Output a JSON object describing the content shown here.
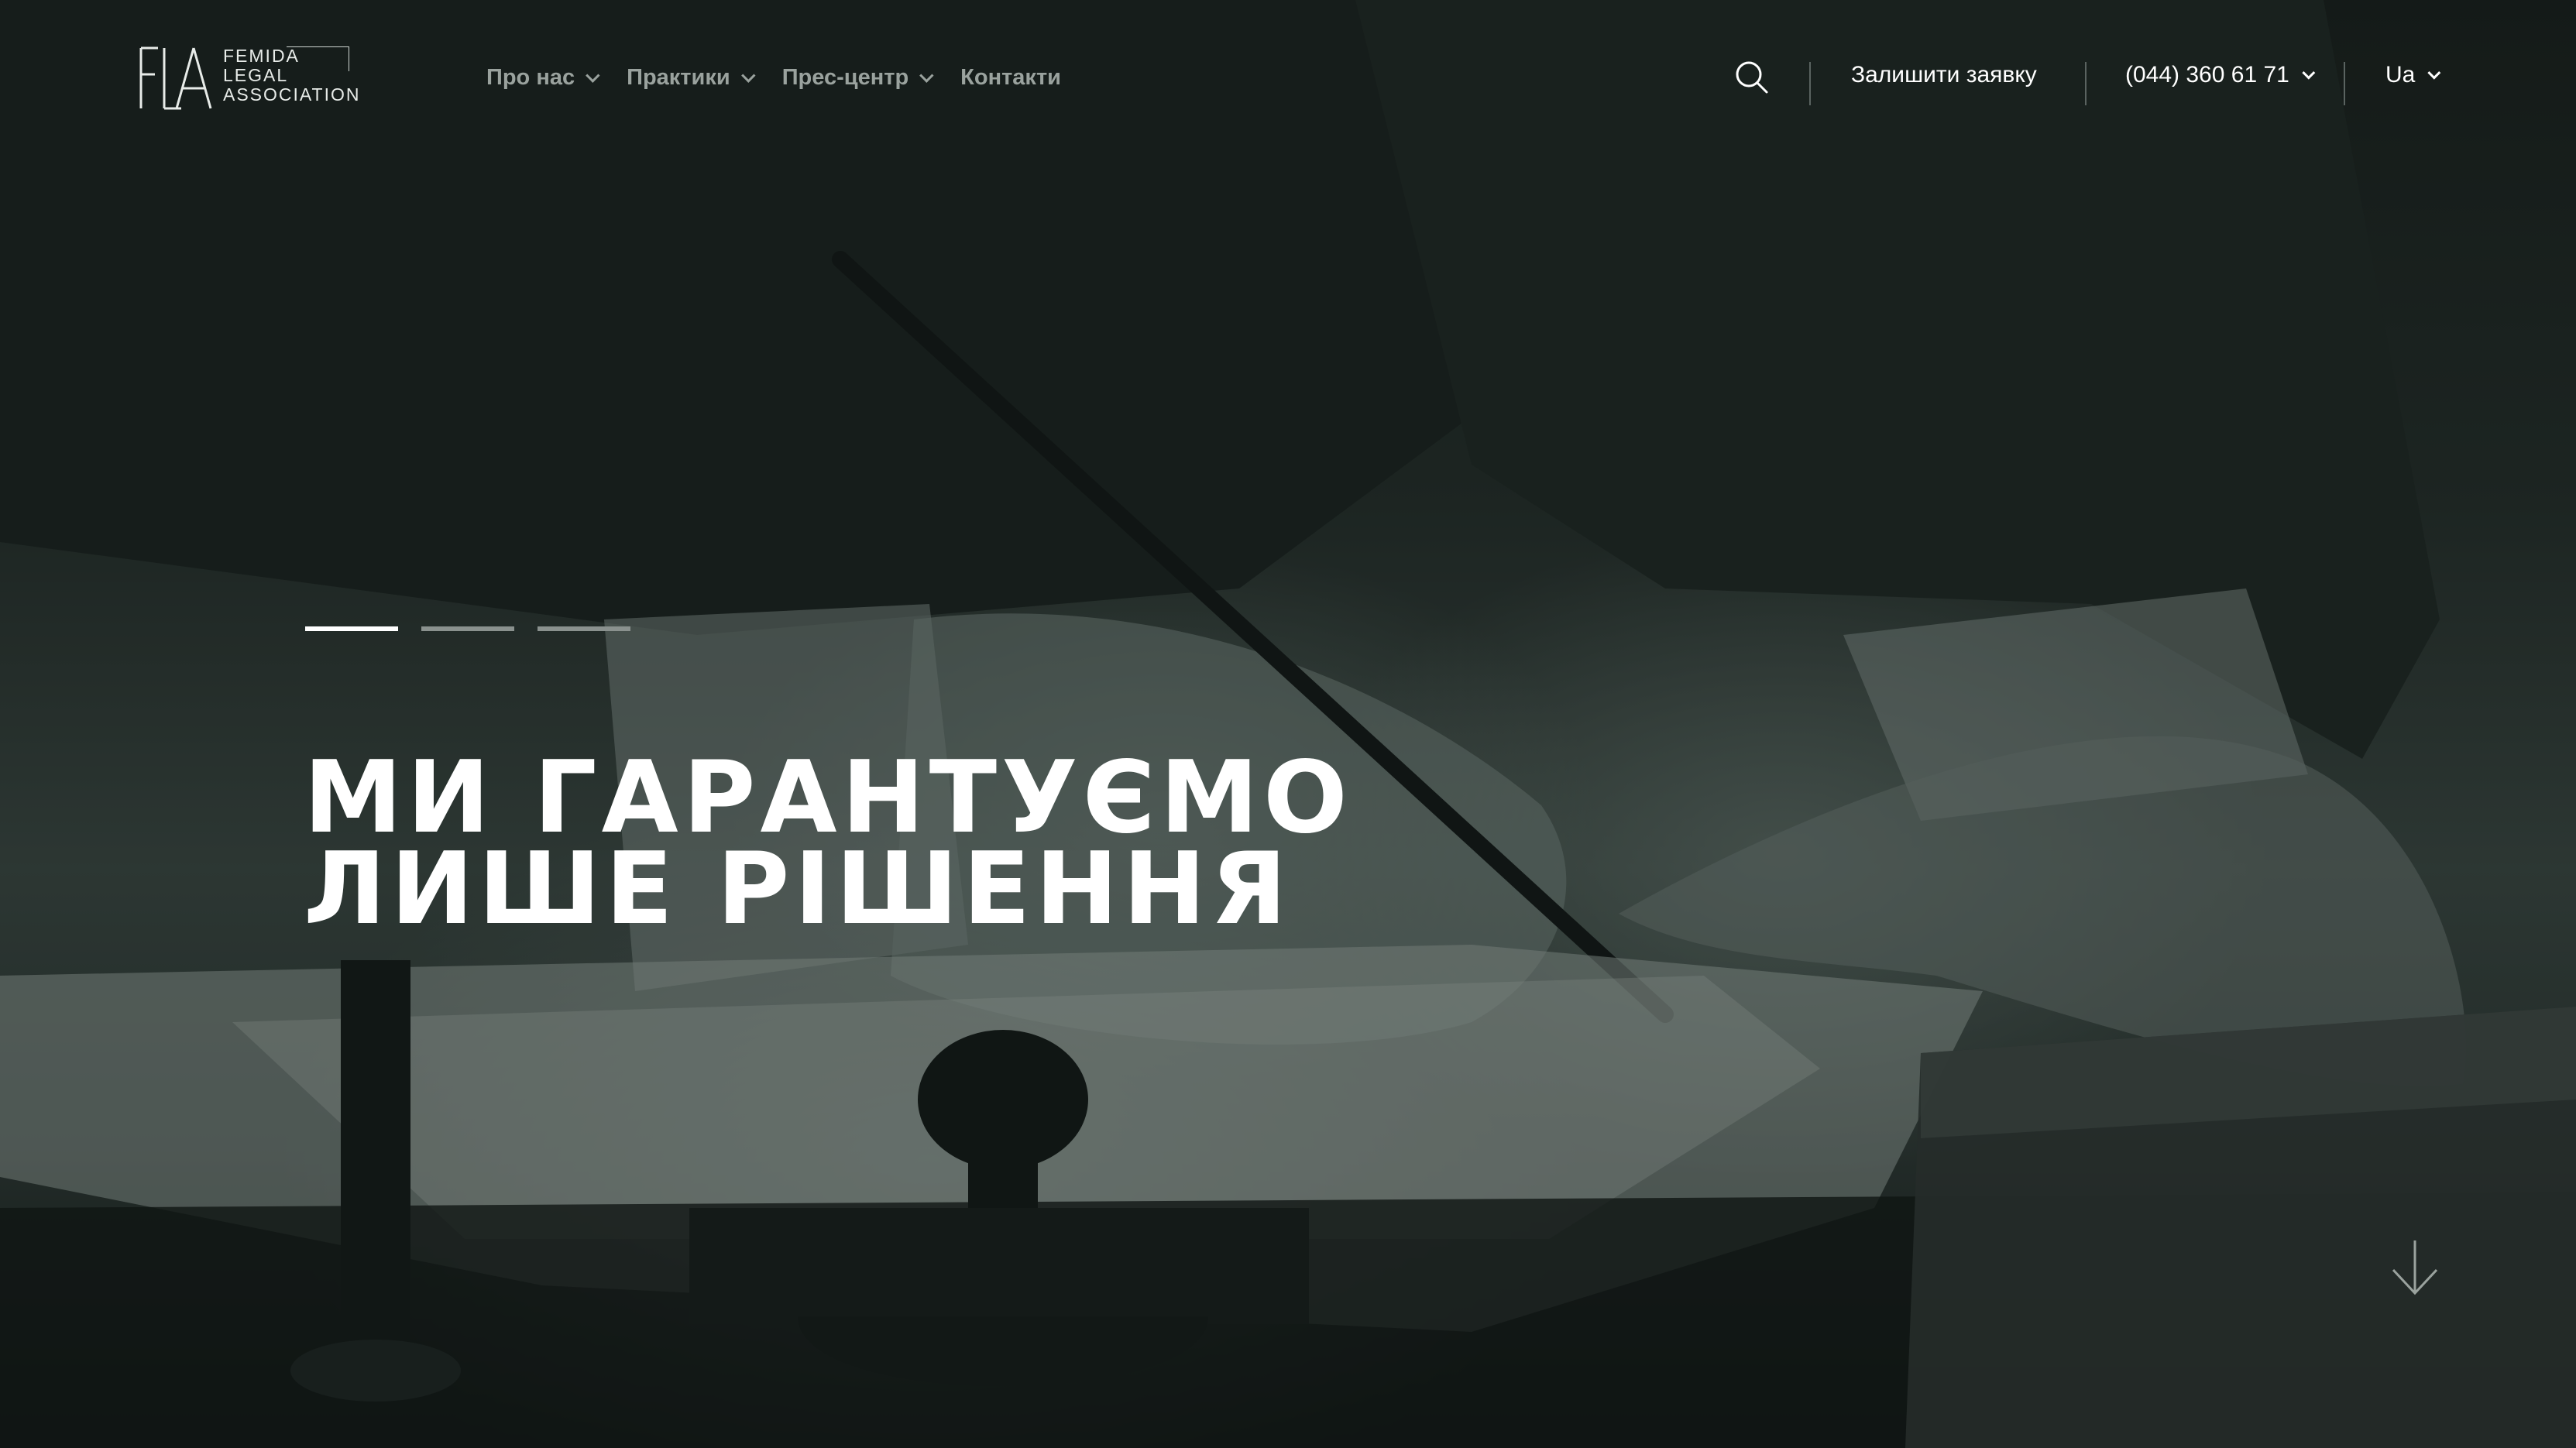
{
  "brand": {
    "line1": "FEMIDA",
    "line2": "LEGAL",
    "line3": "ASSOCIATION",
    "mark": "FLA"
  },
  "nav": {
    "items": [
      {
        "label": "Про нас",
        "has_dropdown": true
      },
      {
        "label": "Практики",
        "has_dropdown": true
      },
      {
        "label": "Прес-центр",
        "has_dropdown": true
      },
      {
        "label": "Контакти",
        "has_dropdown": false
      }
    ]
  },
  "header": {
    "search_icon": "search-icon",
    "cta_label": "Залишити заявку",
    "phone": "(044) 360 61 71",
    "language": "Ua"
  },
  "hero": {
    "slides_total": 3,
    "active_slide": 1,
    "headline_line1": "МИ ГАРАНТУЄМО",
    "headline_line2": "ЛИШЕ РІШЕННЯ",
    "scroll_icon": "arrow-down-icon"
  },
  "colors": {
    "text": "#ffffff",
    "nav_text": "#9aa29e",
    "overlay_tint": "#2b3632"
  }
}
